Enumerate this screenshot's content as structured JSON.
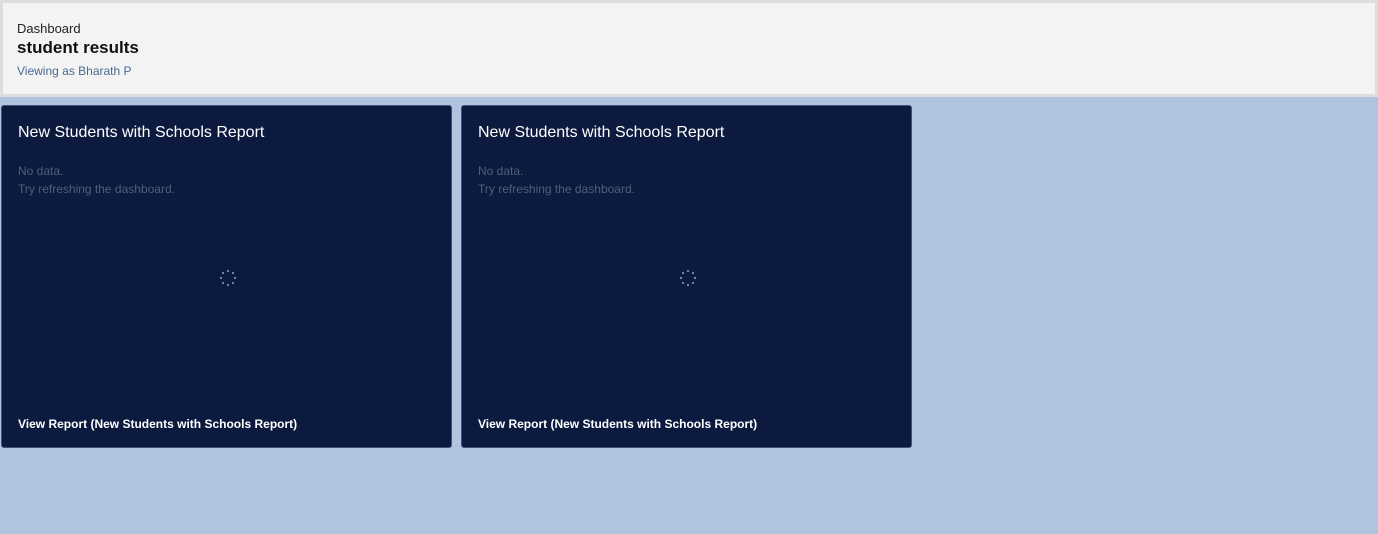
{
  "header": {
    "label": "Dashboard",
    "title": "student results",
    "viewing_as": "Viewing as Bharath P"
  },
  "cards": [
    {
      "title": "New Students with Schools Report",
      "no_data": "No data.",
      "hint": "Try refreshing the dashboard.",
      "link": "View Report (New Students with Schools Report)"
    },
    {
      "title": "New Students with Schools Report",
      "no_data": "No data.",
      "hint": "Try refreshing the dashboard.",
      "link": "View Report (New Students with Schools Report)"
    }
  ],
  "colors": {
    "page_background": "#b0c4df",
    "card_background": "#0b1a3e",
    "header_background": "#f3f3f3",
    "link_accent": "#4a6a94"
  },
  "icons": {
    "loading": "spinner-icon"
  }
}
